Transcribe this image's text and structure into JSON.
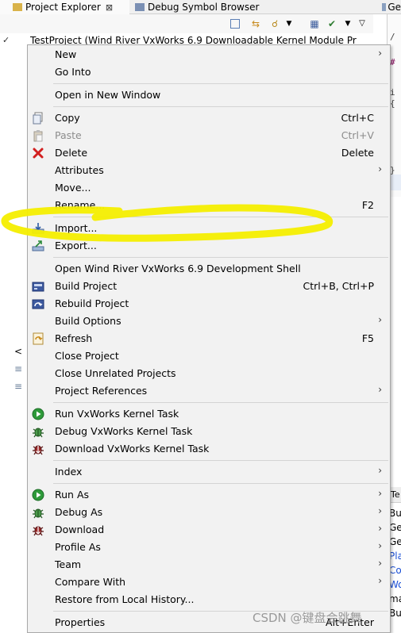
{
  "tabs": [
    {
      "label": "Project Explorer",
      "close": "⊠"
    },
    {
      "label": "Debug Symbol Browser"
    },
    {
      "label": "Ge"
    }
  ],
  "tree": {
    "check": "✓",
    "row_text": "TestProject (Wind River VxWorks 6.9 Downloadable Kernel Module Pr"
  },
  "editor_right_chars": [
    "/",
    "#",
    "i",
    "{",
    "}"
  ],
  "panel_right": {
    "tab": "Te",
    "lines": [
      "Bu",
      "Ge",
      "Ge",
      "Pla",
      "Co",
      "Wo",
      "ma",
      "Bu"
    ]
  },
  "left_strip": [
    "<",
    "≡",
    "≡"
  ],
  "menu": {
    "items": [
      {
        "label": "New",
        "arrow": true,
        "icon": ""
      },
      {
        "label": "Go Into",
        "icon": ""
      },
      {
        "sep": true
      },
      {
        "label": "Open in New Window",
        "icon": ""
      },
      {
        "sep": true
      },
      {
        "label": "Copy",
        "shortcut": "Ctrl+C",
        "icon": "copy-icon"
      },
      {
        "label": "Paste",
        "shortcut": "Ctrl+V",
        "icon": "paste-icon",
        "disabled": true
      },
      {
        "label": "Delete",
        "shortcut": "Delete",
        "icon": "delete-icon"
      },
      {
        "label": "Attributes",
        "arrow": true,
        "icon": ""
      },
      {
        "label": "Move...",
        "icon": ""
      },
      {
        "label": "Rename...",
        "shortcut": "F2",
        "icon": ""
      },
      {
        "sep": true
      },
      {
        "label": "Import...",
        "icon": "import-icon"
      },
      {
        "label": "Export...",
        "icon": "export-icon"
      },
      {
        "sep": true
      },
      {
        "label": "Open Wind River VxWorks 6.9 Development Shell",
        "icon": ""
      },
      {
        "label": "Build Project",
        "shortcut": "Ctrl+B, Ctrl+P",
        "icon": "build-icon"
      },
      {
        "label": "Rebuild Project",
        "icon": "rebuild-icon"
      },
      {
        "label": "Build Options",
        "arrow": true,
        "icon": ""
      },
      {
        "label": "Refresh",
        "shortcut": "F5",
        "icon": "refresh-icon"
      },
      {
        "label": "Close Project",
        "icon": ""
      },
      {
        "label": "Close Unrelated Projects",
        "icon": ""
      },
      {
        "label": "Project References",
        "arrow": true,
        "icon": ""
      },
      {
        "sep": true
      },
      {
        "label": "Run VxWorks Kernel Task",
        "icon": "run-icon"
      },
      {
        "label": "Debug VxWorks Kernel Task",
        "icon": "debug-icon"
      },
      {
        "label": "Download VxWorks Kernel Task",
        "icon": "download-icon"
      },
      {
        "sep": true
      },
      {
        "label": "Index",
        "arrow": true,
        "icon": ""
      },
      {
        "sep": true
      },
      {
        "label": "Run As",
        "arrow": true,
        "icon": "run-icon"
      },
      {
        "label": "Debug As",
        "arrow": true,
        "icon": "debug-icon"
      },
      {
        "label": "Download",
        "arrow": true,
        "icon": "download-icon"
      },
      {
        "label": "Profile As",
        "arrow": true,
        "icon": ""
      },
      {
        "label": "Team",
        "arrow": true,
        "icon": ""
      },
      {
        "label": "Compare With",
        "arrow": true,
        "icon": ""
      },
      {
        "label": "Restore from Local History...",
        "icon": ""
      },
      {
        "sep": true
      },
      {
        "label": "Properties",
        "shortcut": "Alt+Enter",
        "icon": ""
      }
    ]
  },
  "annotation": {
    "color": "#f4ee00"
  },
  "watermark": "CSDN @键盘会跳舞"
}
